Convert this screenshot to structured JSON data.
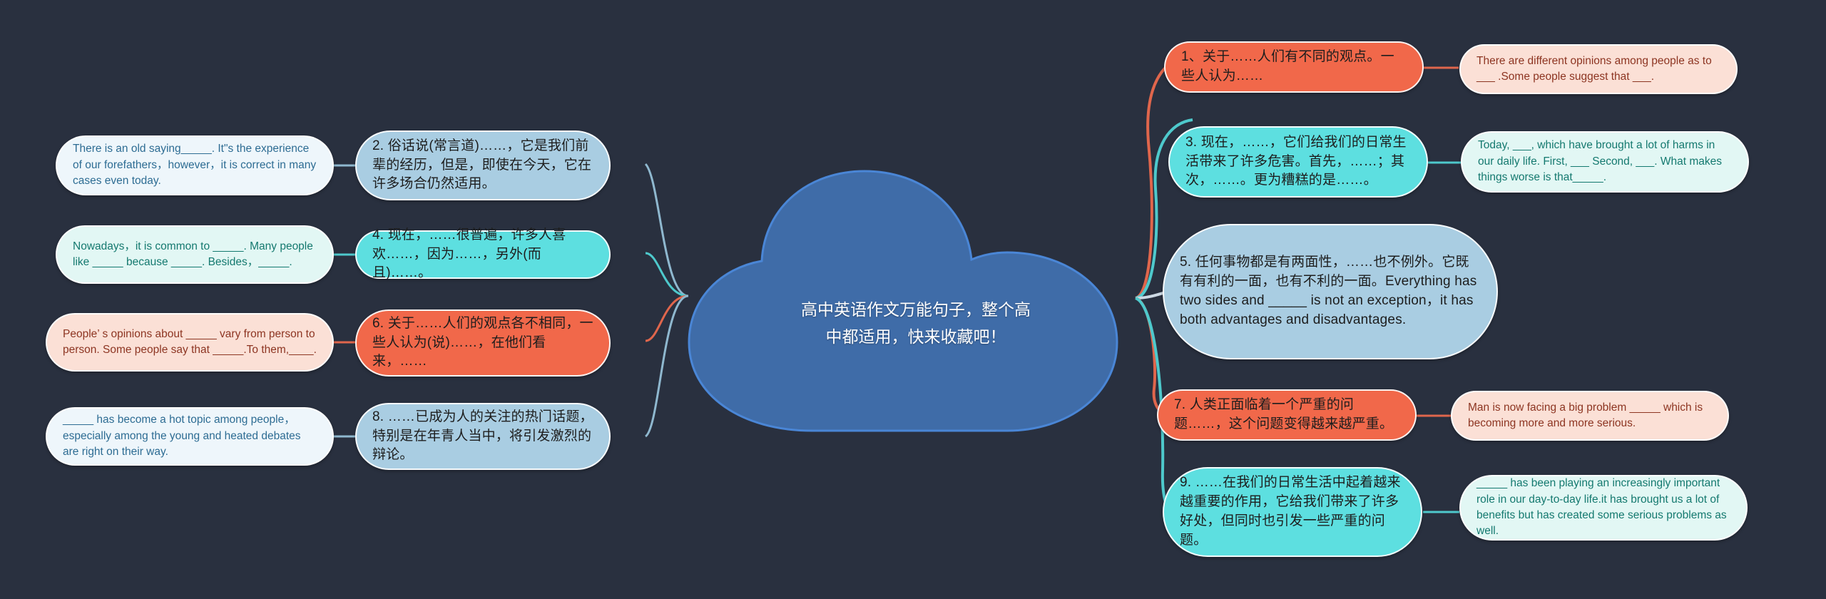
{
  "background_color": "#29303f",
  "center": {
    "title": "高中英语作文万能句子，整个高中都适用，快来收藏吧！",
    "fill": "#3f6ca8",
    "stroke": "#4a86d6",
    "text_color": "#ffffff"
  },
  "left_branches": [
    {
      "id": "branch-2",
      "chinese": "2. 俗话说(常言道)……，它是我们前辈的经历，但是，即使在今天，它在许多场合仍然适用。",
      "english": "There is an old saying_____. It\"s the experience of our  forefathers，however，it is correct in many cases even today.",
      "cn_color": "#a9cde2",
      "en_color": "#eef6fb",
      "link_color": "#8fb8cf"
    },
    {
      "id": "branch-4",
      "chinese": "4. 现在，……很普遍，许多人喜欢……，因为……，另外(而且)……。",
      "english": "Nowadays，it is common to _____. Many people like _____ because _____. Besides，_____.",
      "cn_color": "#5ddfe0",
      "en_color": "#e2f7f4",
      "link_color": "#4ec9cc"
    },
    {
      "id": "branch-6",
      "chinese": "6. 关于……人们的观点各不相同，一些人认为(说)……，在他们看来，……",
      "english": "People’ s opinions about _____ vary from person to person. Some people say  that _____.To them,____.",
      "cn_color": "#f1684a",
      "en_color": "#fbe0d6",
      "link_color": "#e0664c"
    },
    {
      "id": "branch-8",
      "chinese": "8. ……已成为人的关注的热门话题，特别是在年青人当中，将引发激烈的辩论。",
      "english": "_____ has become a hot topic among people，especially among the young and heated debates are right on their way.",
      "cn_color": "#a9cde2",
      "en_color": "#eef6fb",
      "link_color": "#8fb8cf"
    }
  ],
  "right_branches": [
    {
      "id": "branch-1",
      "chinese": "1、关于……人们有不同的观点。一些人认为……",
      "english": "There are different opinions among people as to ___ .Some people suggest that ___.",
      "cn_color": "#f1684a",
      "en_color": "#fbe0d6",
      "link_color": "#e0664c"
    },
    {
      "id": "branch-3",
      "chinese": "3. 现在，……，它们给我们的日常生活带来了许多危害。首先，……；其次，……。更为糟糕的是……。",
      "english": "Today, ___, which have brought a lot of harms in our daily life. First,  ___ Second, ___. What makes things worse is that_____.",
      "cn_color": "#5ddfe0",
      "en_color": "#e2f7f4",
      "link_color": "#4ec9cc"
    },
    {
      "id": "branch-5",
      "chinese": "5. 任何事物都是有两面性，……也不例外。它既有有利的一面，也有不利的一面。Everything has two sides and _____  is not an exception，it has both advantages and disadvantages.",
      "english": "",
      "cn_color": "#a9cde2",
      "en_color": "",
      "link_color": "#cdd9e4"
    },
    {
      "id": "branch-7",
      "chinese": "7. 人类正面临着一个严重的问题……，这个问题变得越来越严重。",
      "english": "Man is now facing a big problem _____ which is becoming more and more serious.",
      "cn_color": "#f1684a",
      "en_color": "#fbe0d6",
      "link_color": "#e0664c"
    },
    {
      "id": "branch-9",
      "chinese": "9. ……在我们的日常生活中起着越来越重要的作用，它给我们带来了许多好处，但同时也引发一些严重的问题。",
      "english": "_____ has been playing an increasingly important role in our day-to-day  life.it has brought us a lot of benefits but has created some serious problems  as well.",
      "cn_color": "#5ddfe0",
      "en_color": "#e2f7f4",
      "link_color": "#4ec9cc"
    }
  ]
}
